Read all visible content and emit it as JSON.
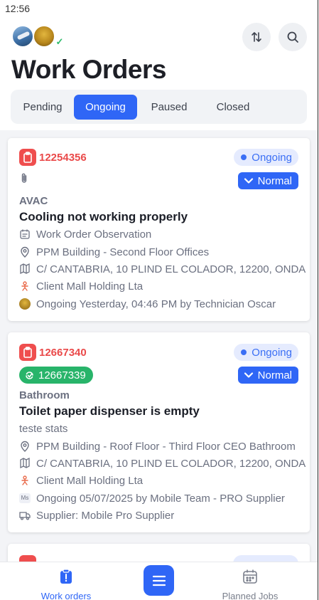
{
  "status_bar": {
    "time": "12:56"
  },
  "header": {
    "title": "Work Orders"
  },
  "tabs": [
    {
      "label": "Pending",
      "active": false
    },
    {
      "label": "Ongoing",
      "active": true
    },
    {
      "label": "Paused",
      "active": false
    },
    {
      "label": "Closed",
      "active": false
    }
  ],
  "orders": [
    {
      "id": "12254356",
      "status": "Ongoing",
      "priority": "Normal",
      "category": "AVAC",
      "title": "Cooling not working properly",
      "observation": "Work Order Observation",
      "location": "PPM Building - Second Floor Offices",
      "address": "C/ CANTABRIA, 10 PLIND EL COLADOR, 12200, ONDA",
      "client": "Client Mall Holding Lta",
      "activity": "Ongoing Yesterday, 04:46 PM by Technician Oscar"
    },
    {
      "id": "12667340",
      "linked_id": "12667339",
      "status": "Ongoing",
      "priority": "Normal",
      "category": "Bathroom",
      "title": "Toilet paper dispenser is empty",
      "note": "teste stats",
      "location": "PPM Building - Roof Floor - Third Floor CEO Bathroom",
      "address": "C/ CANTABRIA, 10 PLIND EL COLADOR, 12200, ONDA",
      "client": "Client Mall Holding Lta",
      "activity_badge": "Ms",
      "activity": "Ongoing 05/07/2025 by Mobile Team - PRO Supplier",
      "supplier": "Supplier: Mobile Pro Supplier"
    }
  ],
  "bottom_nav": {
    "work_orders": "Work orders",
    "planned_jobs": "Planned Jobs"
  },
  "colors": {
    "accent": "#2f66f6",
    "id_red": "#ea4a4a",
    "green": "#28b46a"
  }
}
